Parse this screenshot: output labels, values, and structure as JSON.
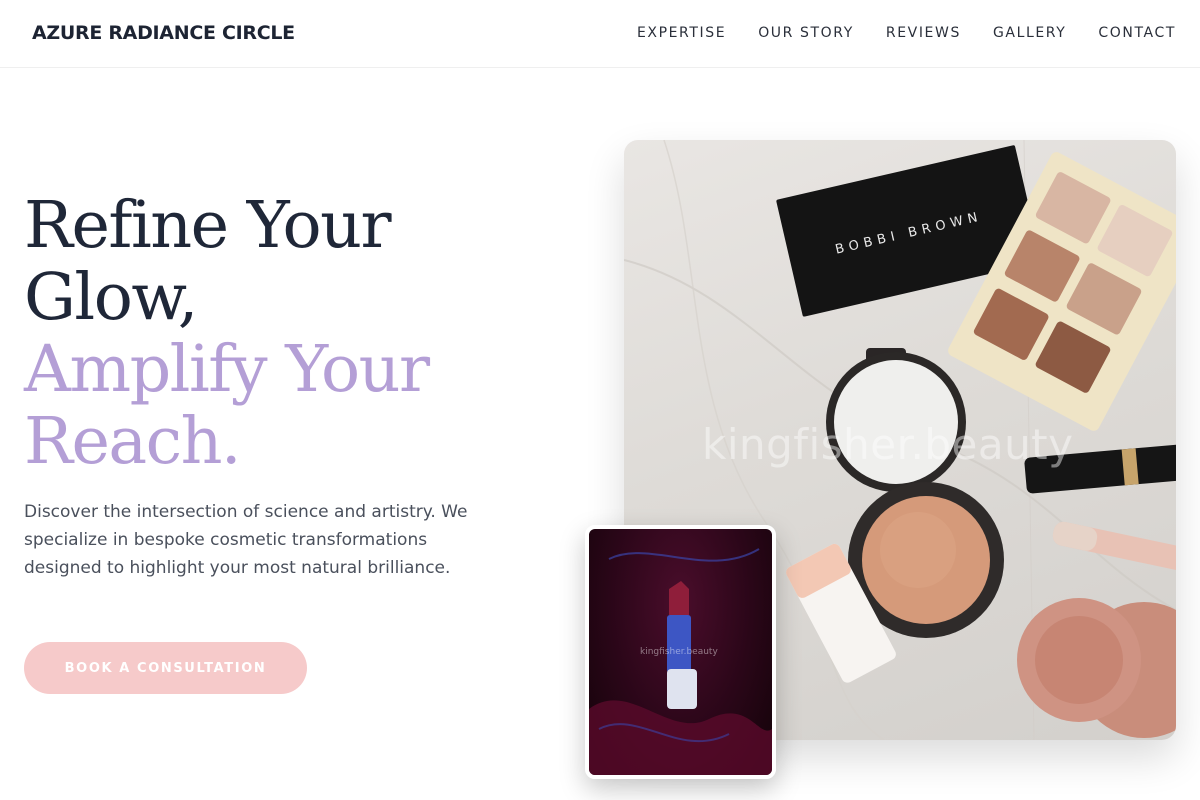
{
  "header": {
    "brand": "AZURE RADIANCE CIRCLE",
    "nav": [
      "EXPERTISE",
      "OUR STORY",
      "REVIEWS",
      "GALLERY",
      "CONTACT"
    ]
  },
  "hero": {
    "headline_dark": [
      "Refine Your",
      "Glow,"
    ],
    "headline_accent": [
      "Amplify Your",
      "Reach."
    ],
    "lead": "Discover the intersection of science and artistry. We specialize in bespoke cosmetic transformations designed to highlight your most natural brilliance.",
    "cta_label": "BOOK A CONSULTATION"
  },
  "media": {
    "main_photo": {
      "palette_brand_text": "BOBBI BROWN",
      "watermark": "kingfisher.beauty"
    },
    "inset_photo": {
      "watermark": "kingfisher.beauty"
    }
  },
  "colors": {
    "heading": "#1f2738",
    "accent": "#b49fd6",
    "cta_background": "#f6caca",
    "body_text": "#4a505c"
  }
}
